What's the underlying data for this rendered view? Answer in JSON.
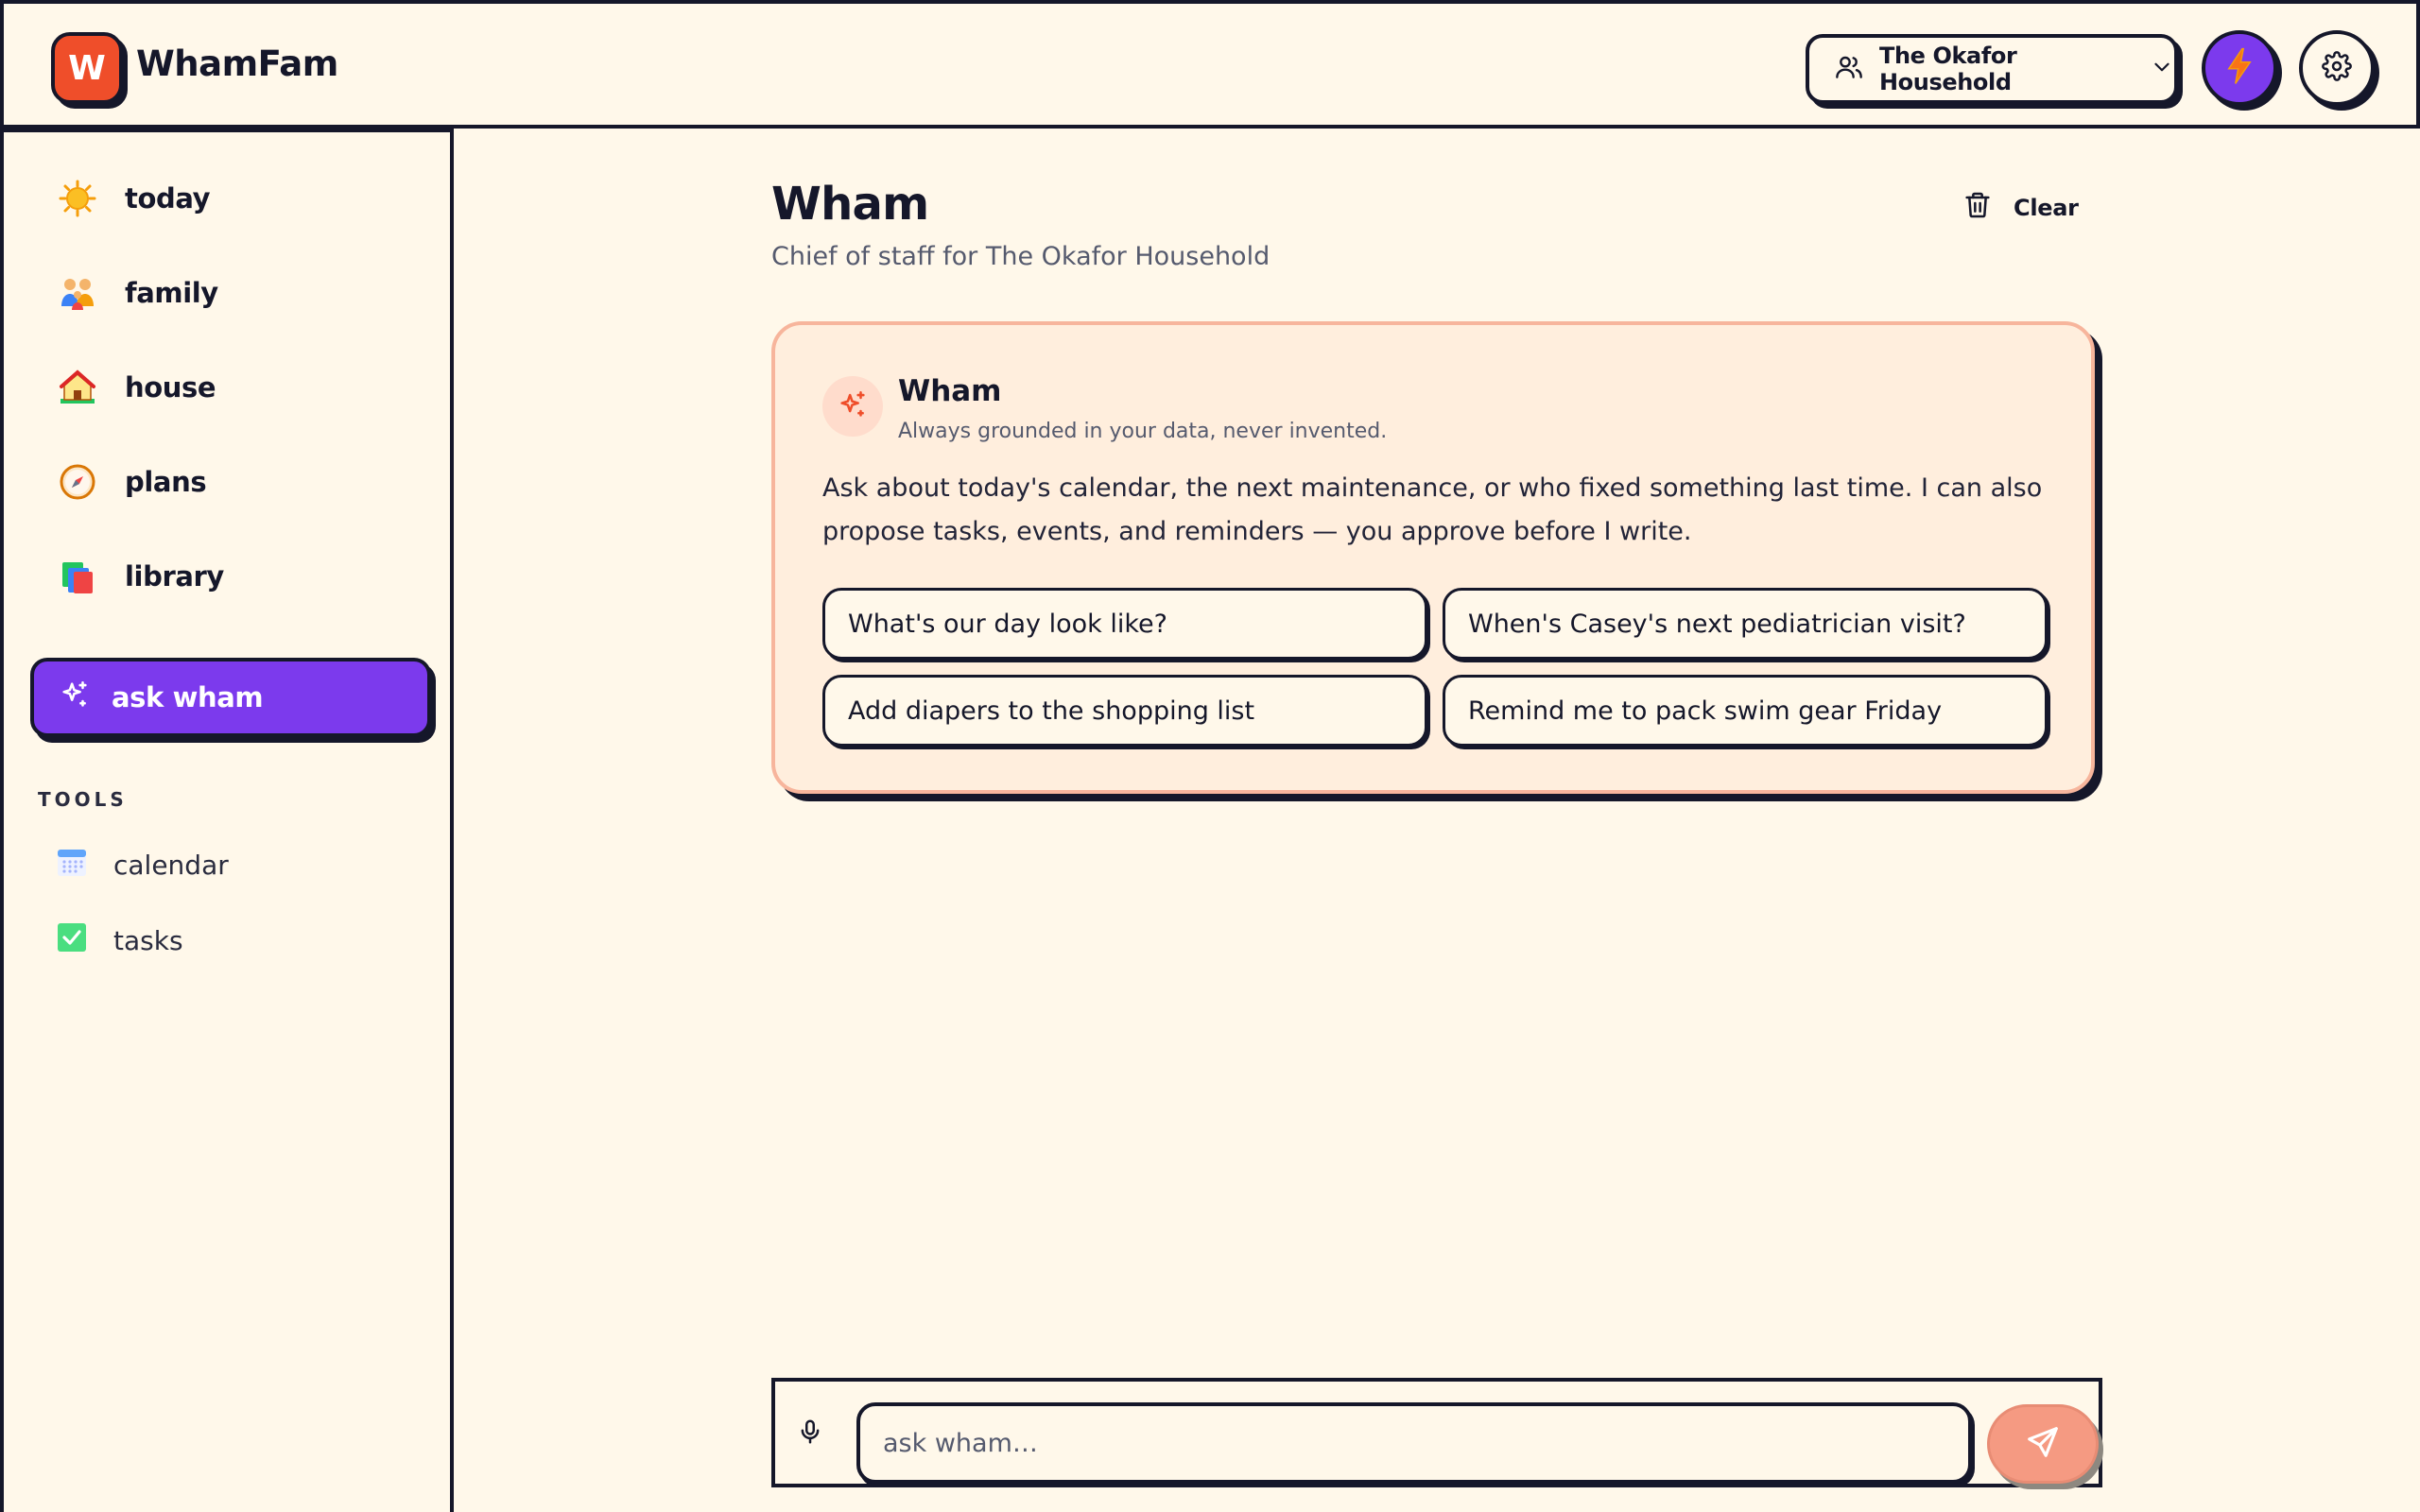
{
  "app": {
    "logo_letter": "W",
    "name": "WhamFam"
  },
  "header": {
    "household": "The Okafor Household",
    "icons": {
      "household": "users-icon",
      "dropdown": "chevron-down-icon",
      "bolt": "lightning-bolt-icon",
      "settings": "gear-icon"
    }
  },
  "sidebar": {
    "nav": [
      {
        "label": "today",
        "icon": "sun-emoji-icon"
      },
      {
        "label": "family",
        "icon": "family-emoji-icon"
      },
      {
        "label": "house",
        "icon": "house-emoji-icon"
      },
      {
        "label": "plans",
        "icon": "compass-emoji-icon"
      },
      {
        "label": "library",
        "icon": "books-emoji-icon"
      }
    ],
    "ask_button": {
      "label": "ask wham",
      "icon": "sparkles-icon"
    },
    "tools_heading": "TOOLS",
    "tools": [
      {
        "label": "calendar",
        "icon": "calendar-icon"
      },
      {
        "label": "tasks",
        "icon": "checkbox-icon"
      }
    ]
  },
  "main": {
    "title": "Wham",
    "subtitle": "Chief of staff for The Okafor Household",
    "clear_label": "Clear",
    "card": {
      "name": "Wham",
      "tagline": "Always grounded in your data, never invented.",
      "body": "Ask about today's calendar, the next maintenance, or who fixed something last time. I can also propose tasks, events, and reminders — you approve before I write.",
      "suggestions": [
        "What's our day look like?",
        "When's Casey's next pediatrician visit?",
        "Add diapers to the shopping list",
        "Remind me to pack swim gear Friday"
      ]
    },
    "composer": {
      "placeholder": "ask wham…",
      "value": ""
    }
  },
  "colors": {
    "background": "#fff8ea",
    "ink": "#15172a",
    "brand_orange": "#ef4e2a",
    "accent_purple": "#7c3aed",
    "card_bg": "#ffeedd",
    "card_border": "#f7b59c",
    "send_button": "#f59a82"
  }
}
